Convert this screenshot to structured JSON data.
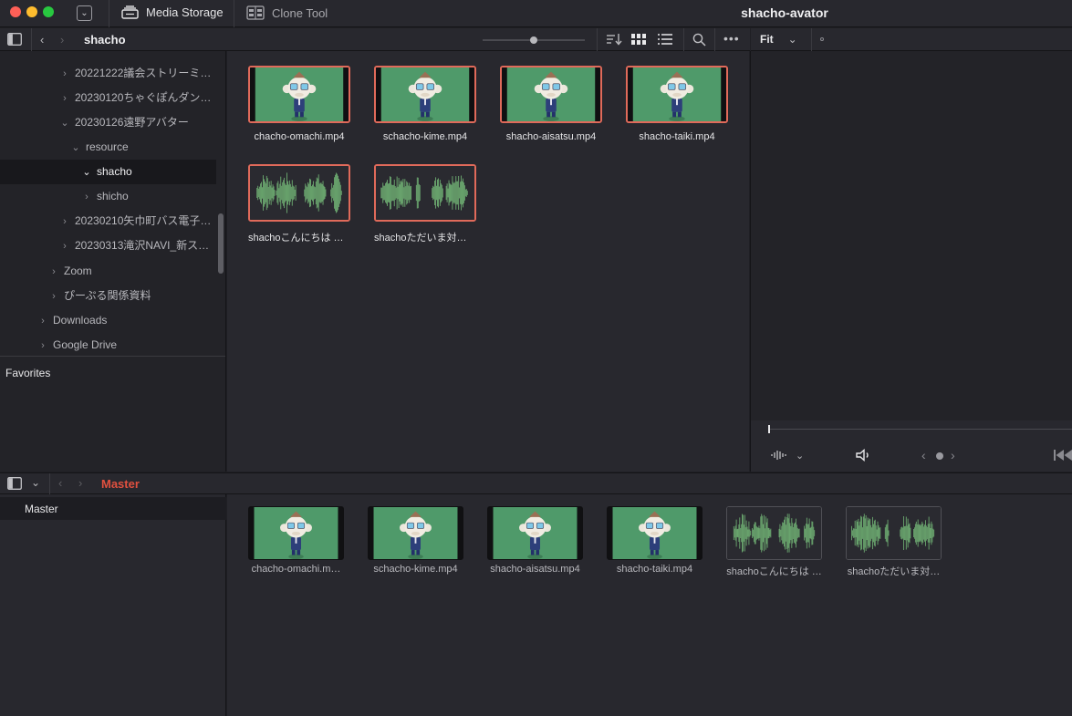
{
  "topbar": {
    "media_storage_label": "Media Storage",
    "clone_tool_label": "Clone Tool",
    "project_title": "shacho-avator"
  },
  "browser": {
    "path": "shacho",
    "zoom": 0.3
  },
  "sidebar": {
    "items": [
      {
        "label": "",
        "indent": 3,
        "expanded": false
      },
      {
        "label": "20221222議会ストリーミ…",
        "indent": 3,
        "expanded": false
      },
      {
        "label": "20230120ちゃぐぽんダン…",
        "indent": 3,
        "expanded": false
      },
      {
        "label": "20230126遠野アバター",
        "indent": 3,
        "expanded": true
      },
      {
        "label": "resource",
        "indent": 4,
        "expanded": true
      },
      {
        "label": "shacho",
        "indent": 5,
        "expanded": true,
        "selected": true
      },
      {
        "label": "shicho",
        "indent": 5,
        "expanded": false
      },
      {
        "label": "20230210矢巾町バス電子…",
        "indent": 3,
        "expanded": false
      },
      {
        "label": "20230313滝沢NAVI_新ス…",
        "indent": 3,
        "expanded": false
      },
      {
        "label": "Zoom",
        "indent": 2,
        "expanded": false
      },
      {
        "label": "ぴーぷる関係資料",
        "indent": 2,
        "expanded": false
      },
      {
        "label": "Downloads",
        "indent": 1,
        "expanded": false
      },
      {
        "label": "Google Drive",
        "indent": 1,
        "expanded": false
      }
    ],
    "favorites_label": "Favorites"
  },
  "clips": [
    {
      "name": "chacho-omachi.mp4",
      "kind": "video"
    },
    {
      "name": "schacho-kime.mp4",
      "kind": "video"
    },
    {
      "name": "shacho-aisatsu.mp4",
      "kind": "video"
    },
    {
      "name": "shacho-taiki.mp4",
      "kind": "video"
    },
    {
      "name": "shachoこんにちは い…",
      "kind": "audio"
    },
    {
      "name": "shachoただいま対応い…",
      "kind": "audio"
    }
  ],
  "viewer": {
    "fit_label": "Fit"
  },
  "media_pool": {
    "title": "Master",
    "bins": [
      "Master"
    ],
    "clips": [
      {
        "name": "chacho-omachi.m…",
        "kind": "video"
      },
      {
        "name": "schacho-kime.mp4",
        "kind": "video"
      },
      {
        "name": "shacho-aisatsu.mp4",
        "kind": "video"
      },
      {
        "name": "shacho-taiki.mp4",
        "kind": "video"
      },
      {
        "name": "shachoこんにちは …",
        "kind": "audio"
      },
      {
        "name": "shachoただいま対…",
        "kind": "audio"
      }
    ]
  },
  "colors": {
    "accent_red": "#e0503f",
    "selection_border": "#e06a5a",
    "greenscreen": "#4f9a6a",
    "waveform": "#6aa56e"
  }
}
